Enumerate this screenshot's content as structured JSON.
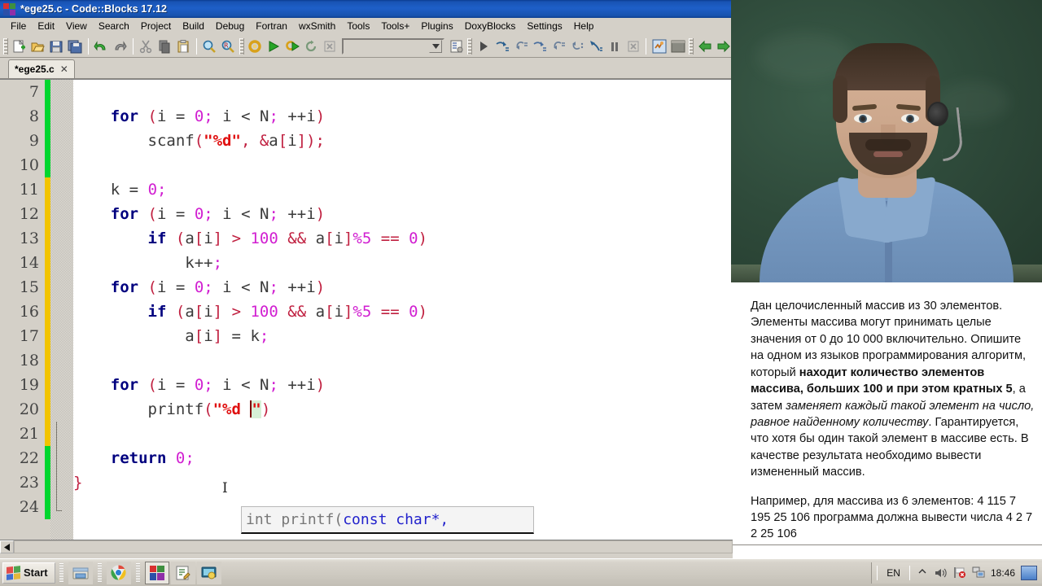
{
  "window": {
    "title": "*ege25.c - Code::Blocks 17.12",
    "logo_icon": "codeblocks-logo-icon"
  },
  "menubar": {
    "items": [
      {
        "label": "File"
      },
      {
        "label": "Edit"
      },
      {
        "label": "View"
      },
      {
        "label": "Search"
      },
      {
        "label": "Project"
      },
      {
        "label": "Build"
      },
      {
        "label": "Debug"
      },
      {
        "label": "Fortran"
      },
      {
        "label": "wxSmith"
      },
      {
        "label": "Tools"
      },
      {
        "label": "Tools+"
      },
      {
        "label": "Plugins"
      },
      {
        "label": "DoxyBlocks"
      },
      {
        "label": "Settings"
      },
      {
        "label": "Help"
      }
    ]
  },
  "toolbar": {
    "icons": [
      "new-file-icon",
      "open-file-icon",
      "save-icon",
      "save-all-icon",
      "undo-icon",
      "redo-icon",
      "cut-icon",
      "copy-icon",
      "paste-icon",
      "find-icon",
      "find-replace-icon",
      "build-icon",
      "run-icon",
      "build-and-run-icon",
      "rebuild-icon",
      "abort-icon",
      "build-target-combo",
      "build-log-icon",
      "debug-continue-icon",
      "debug-next-line-icon",
      "debug-step-into-icon",
      "debug-next-instruction-icon",
      "debug-step-into-instruction-icon",
      "debug-step-out-icon",
      "debug-run-to-cursor-icon",
      "debug-break-icon",
      "debug-stop-icon",
      "various-windows-icon",
      "debugging-windows-icon",
      "back-icon",
      "forward-icon"
    ],
    "combo_value": ""
  },
  "tabs": [
    {
      "label": "*ege25.c",
      "close_icon": "close-icon",
      "active": true
    }
  ],
  "editor": {
    "first_line_number": 7,
    "lines": [
      {
        "n": 7,
        "marker": "saved"
      },
      {
        "n": 8,
        "marker": "saved"
      },
      {
        "n": 9,
        "marker": "saved"
      },
      {
        "n": 10,
        "marker": "saved"
      },
      {
        "n": 11,
        "marker": "unsaved"
      },
      {
        "n": 12,
        "marker": "unsaved"
      },
      {
        "n": 13,
        "marker": "unsaved"
      },
      {
        "n": 14,
        "marker": "unsaved"
      },
      {
        "n": 15,
        "marker": "unsaved"
      },
      {
        "n": 16,
        "marker": "unsaved"
      },
      {
        "n": 17,
        "marker": "unsaved"
      },
      {
        "n": 18,
        "marker": "unsaved"
      },
      {
        "n": 19,
        "marker": "unsaved"
      },
      {
        "n": 20,
        "marker": "unsaved"
      },
      {
        "n": 21,
        "marker": "unsaved"
      },
      {
        "n": 22,
        "marker": "saved"
      },
      {
        "n": 23,
        "marker": "saved"
      },
      {
        "n": 24,
        "marker": "saved"
      }
    ],
    "code_text": [
      "",
      "    for (i = 0; i < N; ++i)",
      "        scanf(\"%d\", &a[i]);",
      "",
      "    k = 0;",
      "    for (i = 0; i < N; ++i)",
      "        if (a[i] > 100 && a[i]%5 == 0)",
      "            k++;",
      "    for (i = 0; i < N; ++i)",
      "        if (a[i] > 100 && a[i]%5 == 0)",
      "            a[i] = k;",
      "",
      "    for (i = 0; i < N; ++i)",
      "        printf(\"%d \")",
      "",
      "    return 0;",
      "}",
      ""
    ],
    "calltip": {
      "prefix": "int printf(",
      "args": "const char*,"
    },
    "mouse_cursor_icon": "text-ibeam-cursor"
  },
  "scrollbar": {
    "left_arrow_icon": "scroll-left-arrow-icon"
  },
  "video": {
    "label": "webcam-overlay",
    "background": "#2f4b3b"
  },
  "problem": {
    "paragraph1_parts": [
      {
        "text": "Дан целочисленный массив из 30 элементов. Элементы массива могут принимать целые значения от 0 до 10 000 включительно. Опишите на одном из языков программирования алгоритм, который ",
        "style": "normal"
      },
      {
        "text": "находит количество элементов массива, больших 100 и при этом кратных 5",
        "style": "bold"
      },
      {
        "text": ", а затем ",
        "style": "normal"
      },
      {
        "text": "заменяет каждый такой элемент на число, равное найденному количеству",
        "style": "italic"
      },
      {
        "text": ". Гарантируется, что хотя бы один такой элемент в массиве есть. В качестве результата необходимо вывести измененный массив.",
        "style": "normal"
      }
    ],
    "paragraph2": "Например, для массива из 6 элементов: 4 115 7 195 25 106 программа должна вывести числа 4 2 7 2 25 106"
  },
  "taskbar": {
    "start_label": "Start",
    "start_icon": "windows-flag-icon",
    "quick_launch": [
      {
        "icon": "file-manager-icon",
        "active": false
      },
      {
        "icon": "chrome-icon",
        "active": false
      },
      {
        "icon": "codeblocks-icon",
        "active": true
      },
      {
        "icon": "notepad-icon",
        "active": false
      },
      {
        "icon": "screen-recorder-icon",
        "active": false
      }
    ],
    "tray": {
      "language": "EN",
      "chevron_icon": "show-hidden-icons-chevron",
      "volume_icon": "speaker-icon",
      "flag_icon": "security-flag-alert-icon",
      "network_icon": "network-icon",
      "time": "18:46",
      "desktop_icon": "show-desktop-icon"
    }
  },
  "colors": {
    "titlebar": "#1e5fc8",
    "chrome": "#d4d0c8",
    "marker_saved": "#00d62e",
    "marker_unsaved": "#f2c400",
    "keyword": "#00007f",
    "number": "#d11fd1",
    "string": "#e01010",
    "punctuation": "#c02040"
  }
}
